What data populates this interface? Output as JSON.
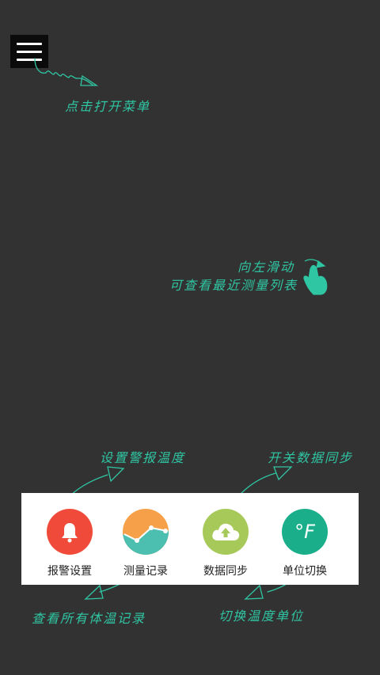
{
  "menu_button": {
    "icon": "hamburger-menu-icon"
  },
  "hints": {
    "menu": "点击打开菜单",
    "swipe_line1": "向左滑动",
    "swipe_line2": "可查看最近测量列表",
    "alarm": "设置警报温度",
    "sync": "开关数据同步",
    "records": "查看所有体温记录",
    "unit": "切换温度单位"
  },
  "toolbar": {
    "items": [
      {
        "label": "报警设置",
        "icon": "bell-icon",
        "color": "#f04a3a"
      },
      {
        "label": "测量记录",
        "icon": "chart-icon",
        "color": "#4dbfb0"
      },
      {
        "label": "数据同步",
        "icon": "cloud-upload-icon",
        "color": "#a7c95a"
      },
      {
        "label": "单位切换",
        "icon": "fahrenheit-icon",
        "color": "#1aae8a",
        "symbol": "°F"
      }
    ]
  },
  "colors": {
    "background": "#323232",
    "hint": "#2fc6a3",
    "panel": "#ffffff"
  }
}
